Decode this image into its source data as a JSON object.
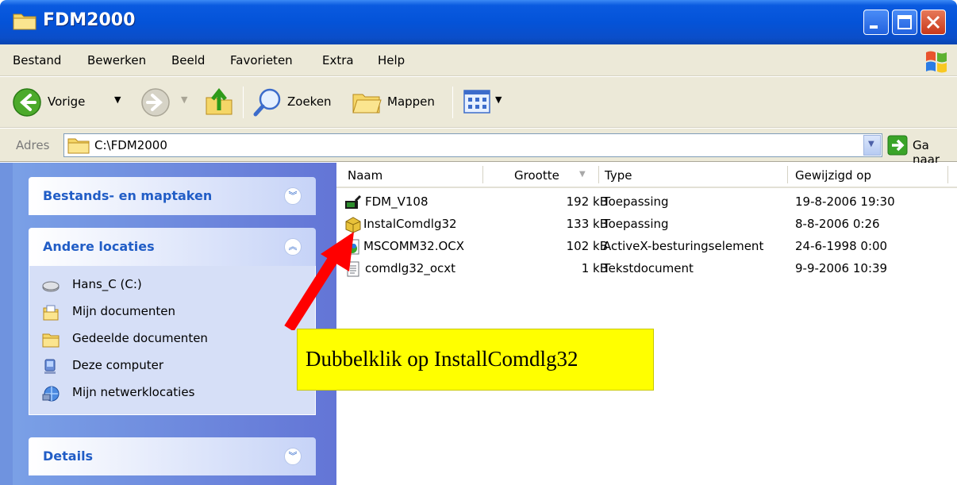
{
  "window": {
    "title": "FDM2000"
  },
  "menu": {
    "items": [
      "Bestand",
      "Bewerken",
      "Beeld",
      "Favorieten",
      "Extra",
      "Help"
    ]
  },
  "toolbar": {
    "back_label": "Vorige",
    "search_label": "Zoeken",
    "folders_label": "Mappen"
  },
  "address": {
    "label": "Adres",
    "path": "C:\\FDM2000",
    "go_label": "Ga naar"
  },
  "leftpane": {
    "tasks_title": "Bestands- en maptaken",
    "other_title": "Andere locaties",
    "other_items": [
      {
        "label": "Hans_C (C:)",
        "icon": "drive-icon"
      },
      {
        "label": "Mijn documenten",
        "icon": "documents-icon"
      },
      {
        "label": "Gedeelde documenten",
        "icon": "folder-icon"
      },
      {
        "label": "Deze computer",
        "icon": "computer-icon"
      },
      {
        "label": "Mijn netwerklocaties",
        "icon": "network-icon"
      }
    ],
    "details_title": "Details"
  },
  "list": {
    "columns": [
      "Naam",
      "Grootte",
      "Type",
      "Gewijzigd op"
    ],
    "rows": [
      {
        "name": "FDM_V108",
        "size": "192 kB",
        "type": "Toepassing",
        "date": "19-8-2006 19:30",
        "icon": "application-icon"
      },
      {
        "name": "InstalComdlg32",
        "size": "133 kB",
        "type": "Toepassing",
        "date": "8-8-2006 0:26",
        "icon": "installer-icon"
      },
      {
        "name": "MSCOMM32.OCX",
        "size": "102 kB",
        "type": "ActiveX-besturingselement",
        "date": "24-6-1998 0:00",
        "icon": "activex-icon"
      },
      {
        "name": "comdlg32_ocxt",
        "size": "1 kB",
        "type": "Tekstdocument",
        "date": "9-9-2006 10:39",
        "icon": "text-document-icon"
      }
    ]
  },
  "annotation": {
    "text": "Dubbelklik op InstallComdlg32"
  }
}
